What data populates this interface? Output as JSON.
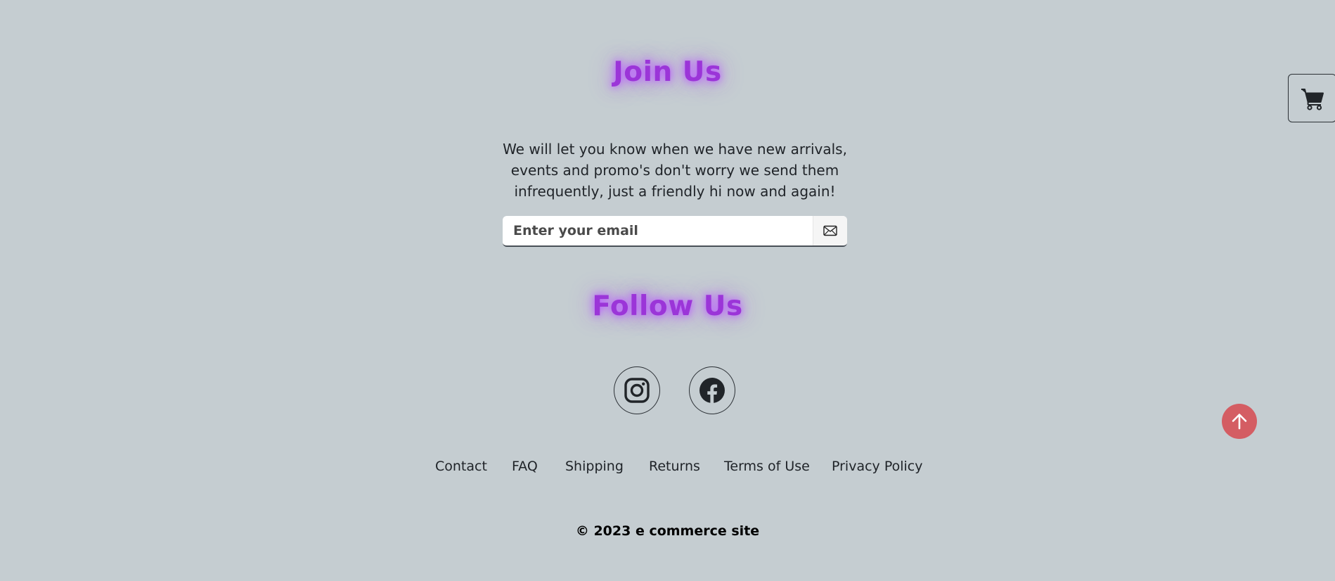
{
  "join": {
    "title": "Join Us",
    "text": "We will let you know when we have new arrivals, events and promo's don't worry we send them infrequently, just a friendly hi now and again!",
    "email_placeholder": "Enter your email",
    "submit_icon": "envelope-icon"
  },
  "follow": {
    "title": "Follow Us",
    "icons": [
      "instagram-icon",
      "facebook-icon"
    ]
  },
  "links": [
    {
      "label": "Contact"
    },
    {
      "label": "FAQ"
    },
    {
      "label": "Shipping"
    },
    {
      "label": "Returns"
    },
    {
      "label": "Terms of Use"
    },
    {
      "label": "Privacy Policy"
    }
  ],
  "copyright": "© 2023 e commerce site",
  "floating": {
    "cart_icon": "cart-icon",
    "scroll_top_icon": "arrow-up-icon"
  },
  "colors": {
    "background": "#c5cdd1",
    "heading": "#9b35d8",
    "glow": "#ba5aff",
    "scroll_top": "#d45d63",
    "text": "#1f2328"
  }
}
